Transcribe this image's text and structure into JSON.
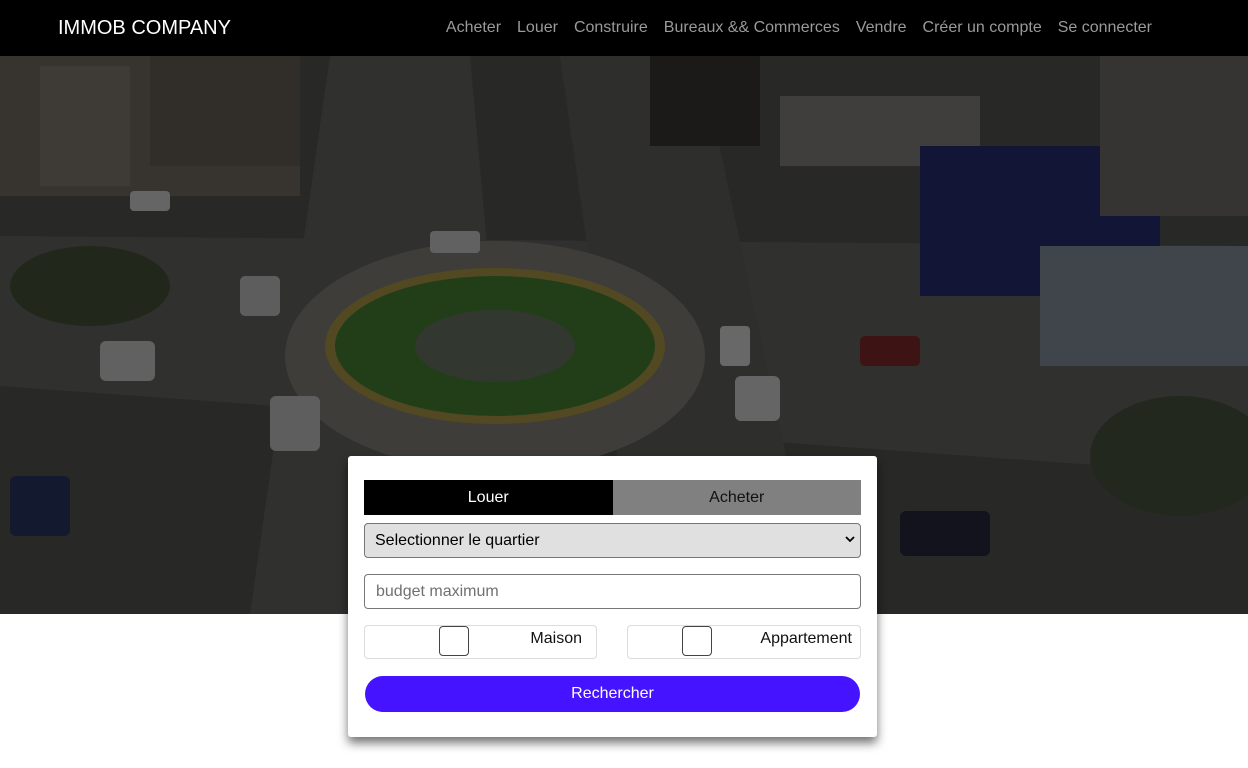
{
  "navbar": {
    "brand": "IMMOB COMPANY",
    "links": [
      "Acheter",
      "Louer",
      "Construire",
      "Bureaux && Commerces",
      "Vendre",
      "Créer un compte",
      "Se connecter"
    ]
  },
  "search": {
    "tabs": {
      "active": "Louer",
      "inactive": "Acheter"
    },
    "quartier_select": "Selectionner le quartier",
    "budget_placeholder": "budget maximum",
    "options": {
      "maison": "Maison",
      "appartement": "Appartement"
    },
    "submit": "Rechercher"
  },
  "colors": {
    "navbar_bg": "#000000",
    "nav_link": "#9a9a9a",
    "tab_active": "#000000",
    "tab_inactive": "#808080",
    "button": "#4513ff"
  }
}
